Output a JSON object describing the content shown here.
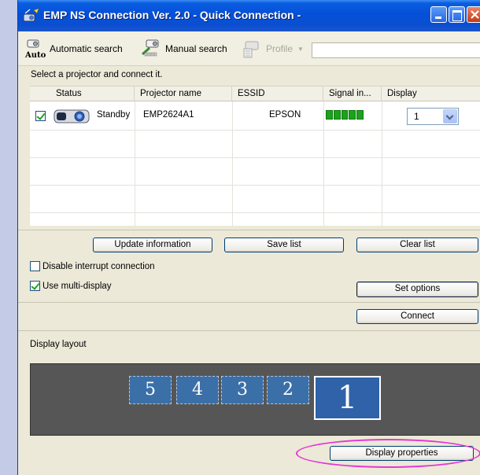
{
  "window": {
    "title": "EMP NS Connection Ver. 2.0 - Quick Connection -",
    "title_icon": "network-projector-icon"
  },
  "toolbar": {
    "automatic_search_label": "Automatic search",
    "automatic_search_icon_text": "Auto",
    "manual_search_label": "Manual search",
    "profile_label": "Profile",
    "profile_combo_value": ""
  },
  "instruction": "Select a projector and connect it.",
  "table": {
    "columns": [
      "Status",
      "Projector name",
      "ESSID",
      "Signal in...",
      "Display"
    ],
    "rows": [
      {
        "checked": true,
        "status": "Standby",
        "projector_name": "EMP2624A1",
        "essid": "EPSON",
        "signal_level": 5,
        "signal_max": 5,
        "display": "1"
      }
    ]
  },
  "buttons": {
    "update_information": "Update information",
    "save_list": "Save list",
    "clear_list": "Clear list",
    "set_options": "Set options",
    "connect": "Connect",
    "display_properties": "Display properties"
  },
  "options": {
    "disable_interrupt_label": "Disable interrupt connection",
    "disable_interrupt_checked": false,
    "use_multi_display_label": "Use multi-display",
    "use_multi_display_checked": true
  },
  "display_layout": {
    "label": "Display layout",
    "monitors": [
      "5",
      "4",
      "3",
      "2",
      "1"
    ],
    "active_monitor": "1"
  },
  "colors": {
    "titlebar": "#0550d8",
    "signal_green": "#1ca21c",
    "highlight": "#e536d6",
    "layout_bg": "#565656",
    "monitor_blue": "#3b6fa8"
  }
}
